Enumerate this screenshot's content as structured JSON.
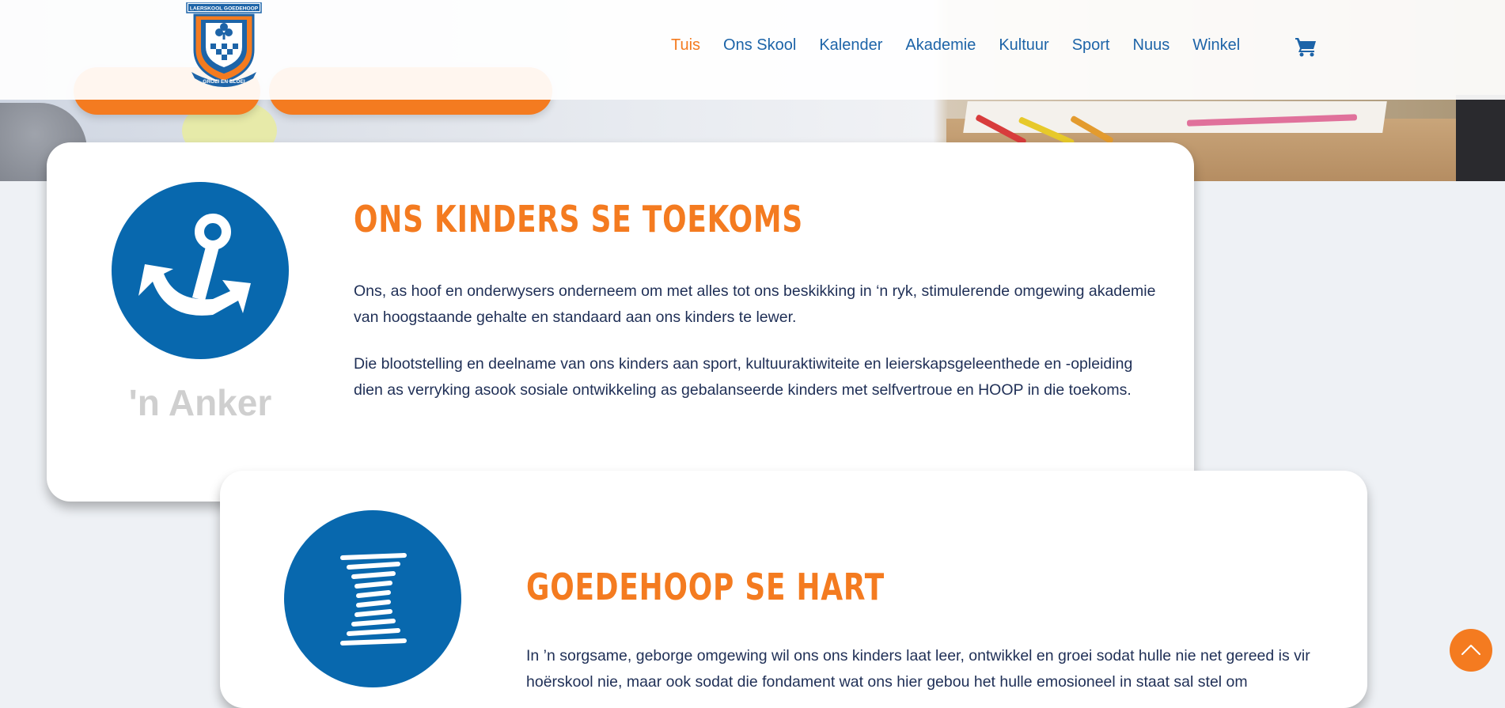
{
  "header": {
    "logo": {
      "top_text": "LAERSKOOL GOEDEHOOP",
      "motto": "GROEI EN BLOEI"
    },
    "nav": [
      {
        "label": "Tuis",
        "active": true
      },
      {
        "label": "Ons Skool",
        "active": false
      },
      {
        "label": "Kalender",
        "active": false
      },
      {
        "label": "Akademie",
        "active": false
      },
      {
        "label": "Kultuur",
        "active": false
      },
      {
        "label": "Sport",
        "active": false
      },
      {
        "label": "Nuus",
        "active": false
      },
      {
        "label": "Winkel",
        "active": false
      }
    ],
    "cart_icon": "shopping-cart-icon"
  },
  "colors": {
    "brand_blue": "#0868ae",
    "accent_orange": "#f47b20",
    "body_text": "#1f2f56",
    "label_grey": "#cfcfcf"
  },
  "cards": [
    {
      "icon": "anchor-icon",
      "label": "'n Anker",
      "title": "ONS KINDERS SE TOEKOMS",
      "paragraphs": [
        "Ons, as hoof en onderwysers onderneem om met alles tot ons beskikking in ‘n ryk, stimulerende omgewing akademie van hoogstaande gehalte en standaard aan ons kinders te lewer.",
        "Die blootstelling en deelname van ons kinders aan sport, kultuuraktiwiteite en leierskapsgeleenthede en -opleiding dien as verryking asook sosiale ontwikkeling as gebalanseerde kinders met selfvertroue en HOOP in die toekoms."
      ]
    },
    {
      "icon": "spring-icon",
      "title": "GOEDEHOOP SE HART",
      "paragraphs": [
        "In ’n sorgsame, geborge omgewing wil ons ons kinders laat leer, ontwikkel en groei sodat hulle nie net gereed is vir hoërskool nie, maar ook sodat die fondament wat ons hier gebou het hulle emosioneel in staat sal stel om"
      ]
    }
  ],
  "back_to_top_icon": "chevron-up-icon"
}
